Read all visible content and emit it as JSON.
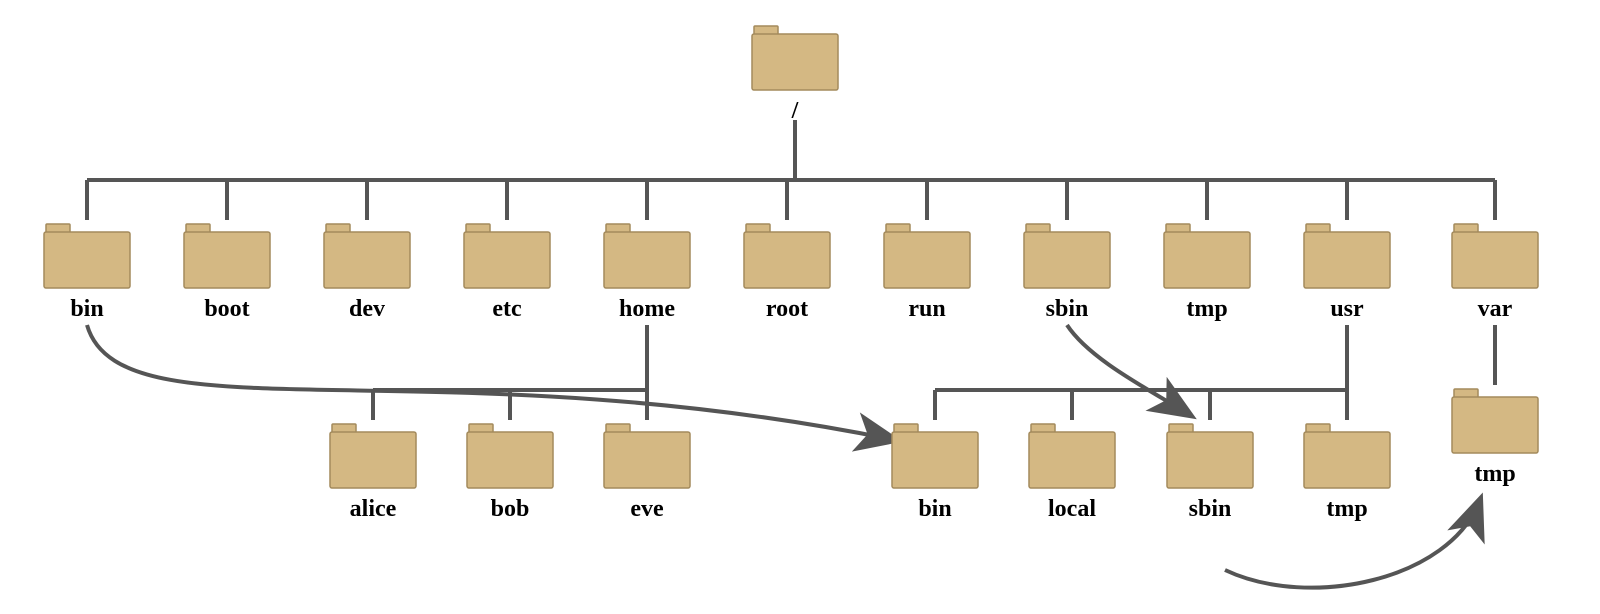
{
  "diagram": {
    "root": {
      "id": "root",
      "label": "/"
    },
    "level1": [
      {
        "id": "bin",
        "label": "bin"
      },
      {
        "id": "boot",
        "label": "boot"
      },
      {
        "id": "dev",
        "label": "dev"
      },
      {
        "id": "etc",
        "label": "etc"
      },
      {
        "id": "home",
        "label": "home"
      },
      {
        "id": "root-dir",
        "label": "root"
      },
      {
        "id": "run",
        "label": "run"
      },
      {
        "id": "sbin",
        "label": "sbin"
      },
      {
        "id": "tmp",
        "label": "tmp"
      },
      {
        "id": "usr",
        "label": "usr"
      },
      {
        "id": "var",
        "label": "var"
      }
    ],
    "home_children": [
      {
        "id": "alice",
        "label": "alice"
      },
      {
        "id": "bob",
        "label": "bob"
      },
      {
        "id": "eve",
        "label": "eve"
      }
    ],
    "usr_children": [
      {
        "id": "usr-bin",
        "label": "bin"
      },
      {
        "id": "usr-local",
        "label": "local"
      },
      {
        "id": "usr-sbin",
        "label": "sbin"
      },
      {
        "id": "usr-tmp",
        "label": "tmp"
      }
    ],
    "var_children": [
      {
        "id": "var-tmp",
        "label": "tmp"
      }
    ],
    "symlinks": [
      {
        "from": "bin",
        "to": "usr-bin"
      },
      {
        "from": "sbin",
        "to": "usr-sbin"
      },
      {
        "from": "tmp",
        "to": "var-tmp"
      }
    ],
    "colors": {
      "folder_fill": "#d4b883",
      "folder_stroke": "#a38a5c",
      "line": "#555555"
    }
  }
}
